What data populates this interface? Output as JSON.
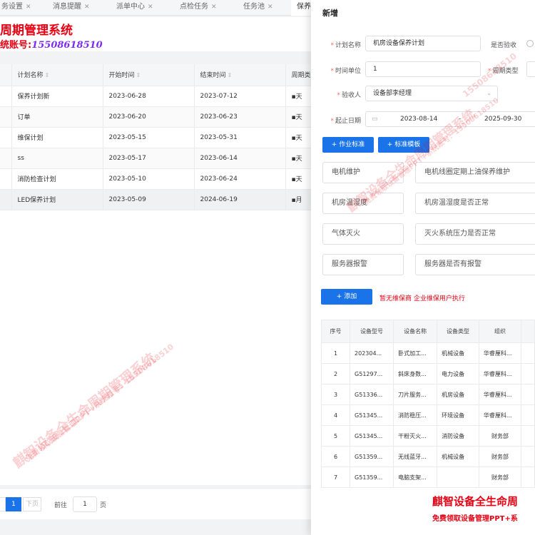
{
  "tabs": [
    {
      "label": "务设置"
    },
    {
      "label": "消息提醒"
    },
    {
      "label": "派单中心"
    },
    {
      "label": "点检任务"
    },
    {
      "label": "任务池"
    },
    {
      "label": "保养"
    }
  ],
  "brand": {
    "title": "周期管理系统",
    "sub_label": "统账号:",
    "sub_number": "15508618510"
  },
  "table": {
    "headers": [
      "计划名称",
      "开始时间",
      "结束时间",
      "周期类"
    ],
    "rows": [
      {
        "name": "保养计划新",
        "start": "2023-06-28",
        "end": "2023-07-12",
        "period": "天"
      },
      {
        "name": "订单",
        "start": "2023-06-20",
        "end": "2023-06-23",
        "period": "天"
      },
      {
        "name": "维保计划",
        "start": "2023-05-15",
        "end": "2023-05-31",
        "period": "天"
      },
      {
        "name": "ss",
        "start": "2023-05-17",
        "end": "2023-06-14",
        "period": "天"
      },
      {
        "name": "消防检查计划",
        "start": "2023-05-10",
        "end": "2023-06-24",
        "period": "天"
      },
      {
        "name": "LED保养计划",
        "start": "2023-05-09",
        "end": "2024-06-19",
        "period": "月"
      }
    ]
  },
  "pager": {
    "page": "1",
    "next": "下页",
    "goto_prefix": "前往",
    "goto_value": "1",
    "goto_suffix": "页"
  },
  "drawer": {
    "title": "新增",
    "plan_name_label": "计划名称",
    "plan_name_value": "机房设备保养计划",
    "accept_label": "是否验收",
    "time_unit_label": "时间单位",
    "time_unit_value": "1",
    "period_type_label": "周期类型",
    "acceptor_label": "验收人",
    "acceptor_value": "设备部李经理",
    "date_label": "起止日期",
    "date_start": "2023-08-14",
    "date_sep": "-",
    "date_end": "2025-09-30",
    "btn_standard": "+ 作业标准",
    "btn_template": "+ 标准模板",
    "standards": [
      {
        "name": "电机维护",
        "desc": "电机线圈定期上油保养维护"
      },
      {
        "name": "机房温湿度",
        "desc": "机房温湿度是否正常"
      },
      {
        "name": "气体灭火",
        "desc": "灭火系统压力是否正常"
      },
      {
        "name": "服务器报警",
        "desc": "服务器是否有报警"
      }
    ],
    "btn_add": "+ 添加",
    "add_note": "暂无维保商 企业维保用户执行",
    "equip_headers": [
      "序号",
      "设备型号",
      "设备名称",
      "设备类型",
      "组织"
    ],
    "equip_rows": [
      {
        "no": "1",
        "model": "202304...",
        "name": "卧式加工...",
        "type": "机械设备",
        "org": "华睿厘科..."
      },
      {
        "no": "2",
        "model": "G51297...",
        "name": "斜床身数...",
        "type": "电力设备",
        "org": "华睿厘科..."
      },
      {
        "no": "3",
        "model": "G51336...",
        "name": "刀片服务...",
        "type": "机房设备",
        "org": "华睿厘科..."
      },
      {
        "no": "4",
        "model": "G51345...",
        "name": "消防稳压...",
        "type": "环境设备",
        "org": "华睿厘科..."
      },
      {
        "no": "5",
        "model": "G51345...",
        "name": "干粉灭火...",
        "type": "消防设备",
        "org": "财务部"
      },
      {
        "no": "6",
        "model": "G51359...",
        "name": "无线蓝牙...",
        "type": "机械设备",
        "org": "财务部"
      },
      {
        "no": "7",
        "model": "G51359...",
        "name": "电脑支架...",
        "type": "",
        "org": "财务部"
      }
    ],
    "promo_title": "麒智设备全生命周",
    "promo_sub": "免费领取设备管理PPT+系"
  },
  "watermark": {
    "line1": "麒智设备全生命周期管理系统",
    "line2": "免费领取设备管理PPT+系统账号：15508618510",
    "phone": "15508618510"
  },
  "colors": {
    "primary": "#1a73e8",
    "brand_red": "#e60012",
    "brand_purple": "#7b2df0"
  }
}
